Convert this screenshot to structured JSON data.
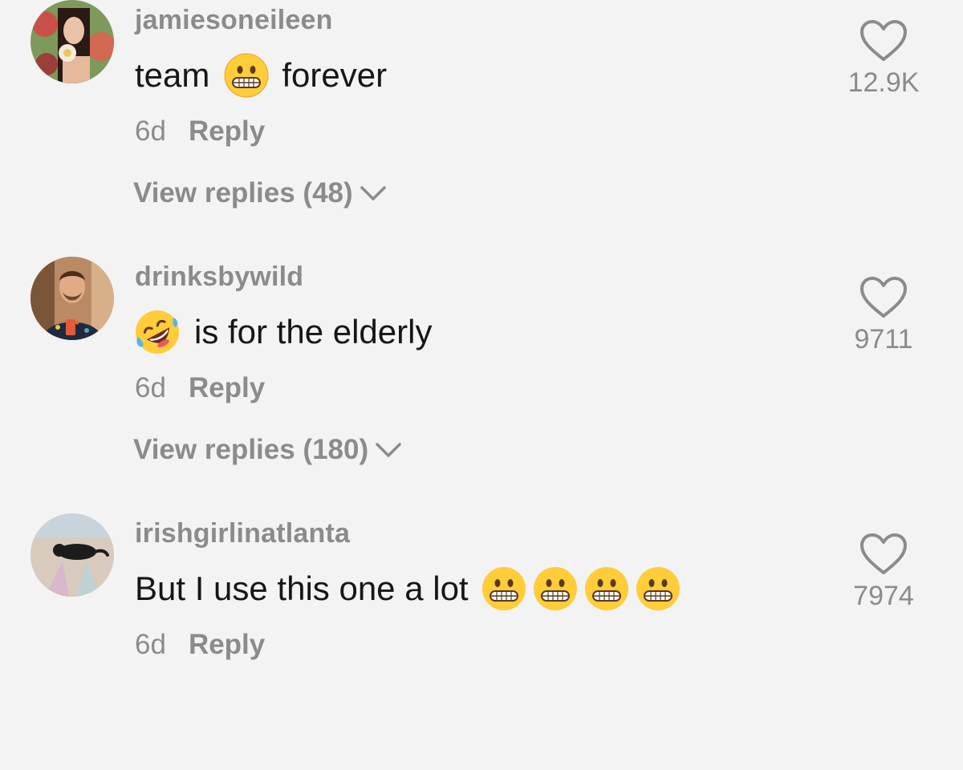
{
  "comments": [
    {
      "username": "jamiesoneileen",
      "text_before": "team",
      "emoji_count": 1,
      "text_after": "forever",
      "emoji": "grimacing-face",
      "age": "6d",
      "reply_label": "Reply",
      "view_replies": "View replies (48)",
      "likes": "12.9K"
    },
    {
      "username": "drinksbywild",
      "emoji": "rolling-on-the-floor-laughing",
      "text_after": "is for the elderly",
      "age": "6d",
      "reply_label": "Reply",
      "view_replies": "View replies (180)",
      "likes": "9711"
    },
    {
      "username": "irishgirlinatlanta",
      "text_before": "But I use this one a lot",
      "emoji": "grimacing-face",
      "emoji_count": 4,
      "age": "6d",
      "reply_label": "Reply",
      "likes": "7974"
    }
  ],
  "colors": {
    "background": "#f3f3f3",
    "muted_text": "#8b8b8b",
    "body_text": "#161616",
    "emoji_yellow": "#ffcc3a"
  }
}
